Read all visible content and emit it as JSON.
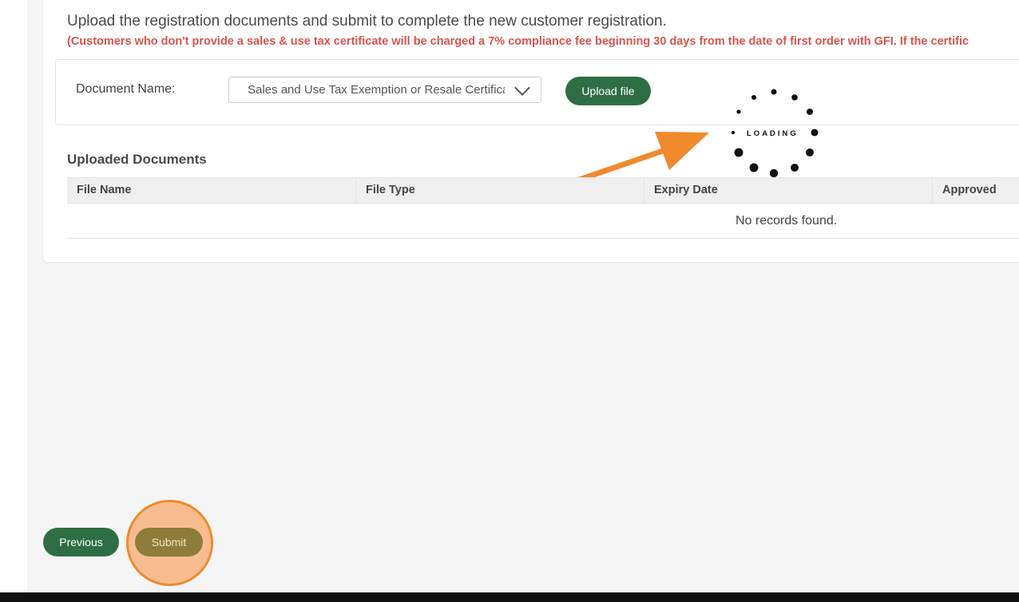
{
  "page": {
    "heading": "Upload the registration documents and submit to complete the new customer registration.",
    "notice": "(Customers who don't provide a sales & use tax certificate will be charged a 7% compliance fee beginning 30 days from the date of first order with GFI. If the certific"
  },
  "document_form": {
    "label": "Document Name:",
    "selected_value": "Sales and Use Tax Exemption or Resale Certificate",
    "upload_label": "Upload file"
  },
  "uploaded": {
    "title": "Uploaded Documents",
    "columns": [
      "File Name",
      "File Type",
      "Expiry Date",
      "Approved"
    ],
    "empty_text": "No records found."
  },
  "loading": {
    "text": "LOADING"
  },
  "footer": {
    "previous_label": "Previous",
    "submit_label": "Submit"
  },
  "colors": {
    "primary_green": "#2e6e45",
    "notice_red": "#d9534f",
    "highlight_orange": "#f08a2c"
  }
}
